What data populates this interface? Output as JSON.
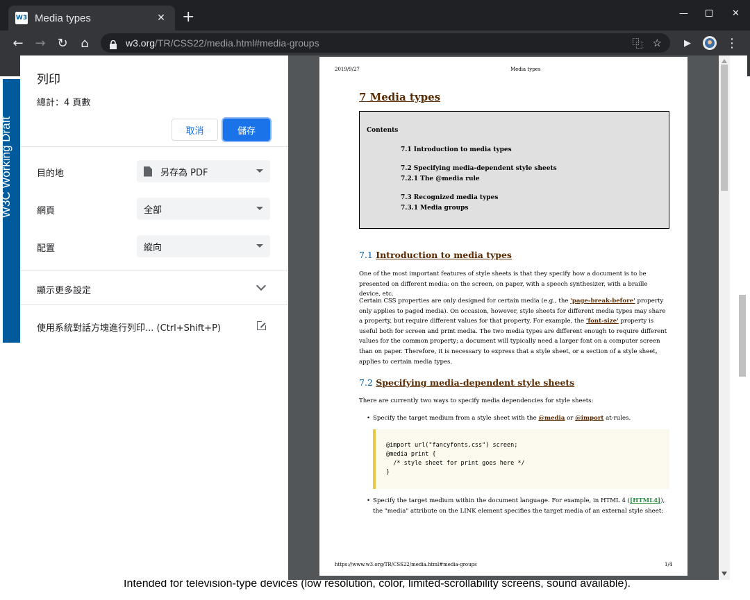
{
  "browser": {
    "tab_title": "Media types",
    "tab_favicon_text": "W3",
    "url_host": "w3.org",
    "url_path": "/TR/CSS22/media.html#media-groups"
  },
  "background_page": {
    "side_label": "W3C Working Draft",
    "bottom_text": "Intended for television-type devices (low resolution, color, limited-scrollability screens, sound available)."
  },
  "print_dialog": {
    "title": "列印",
    "total": "總計：4 頁數",
    "cancel_label": "取消",
    "save_label": "儲存",
    "destination_label": "目的地",
    "destination_value": "另存為 PDF",
    "pages_label": "網頁",
    "pages_value": "全部",
    "layout_label": "配置",
    "layout_value": "縱向",
    "more_settings_label": "顯示更多設定",
    "system_print_label": "使用系統對話方塊進行列印... (Ctrl+Shift+P)"
  },
  "preview_page": {
    "date": "2019/9/27",
    "header_title": "Media types",
    "h1": "7 Media types",
    "toc_title": "Contents",
    "toc": {
      "item1": "7.1 Introduction to media types",
      "item2": "7.2 Specifying media-dependent style sheets",
      "item3": "7.2.1 The @media rule",
      "item4": "7.3 Recognized media types",
      "item5": "7.3.1 Media groups"
    },
    "s71_num": "7.1",
    "s71_title": "Introduction to media types",
    "p1": "One of the most important features of style sheets is that they specify how a document is to be presented on different media: on the screen, on paper, with a speech synthesizer, with a braille device, etc.",
    "p2_a": "Certain CSS properties are only designed for certain media (e.g., the ",
    "p2_link1": "'page-break-before'",
    "p2_b": " property only applies to paged media). On occasion, however, style sheets for different media types may share a property, but require different values for that property. For example, the ",
    "p2_link2": "'font-size'",
    "p2_c": " property is useful both for screen and print media. The two media types are different enough to require different values for the common property; a document will typically need a larger font on a computer screen than on paper. Therefore, it is necessary to express that a style sheet, or a section of a style sheet, applies to certain media types.",
    "s72_num": "7.2",
    "s72_title": "Specifying media-dependent style sheets",
    "p3": "There are currently two ways to specify media dependencies for style sheets:",
    "b1_a": "Specify the target medium from a style sheet with the ",
    "b1_link1": "@media",
    "b1_b": " or ",
    "b1_link2": "@import",
    "b1_c": " at-rules.",
    "code": "@import url(\"fancyfonts.css\") screen;\n@media print {\n  /* style sheet for print goes here */\n}",
    "b2_a": "Specify the target medium within the document language. For example, in HTML 4 (",
    "b2_ref": "[HTML4]",
    "b2_b": "), the \"media\" attribute on the LINK element specifies the target media of an external style sheet:",
    "footer_url": "https://www.w3.org/TR/CSS22/media.html#media-groups",
    "page_number": "1/4"
  }
}
